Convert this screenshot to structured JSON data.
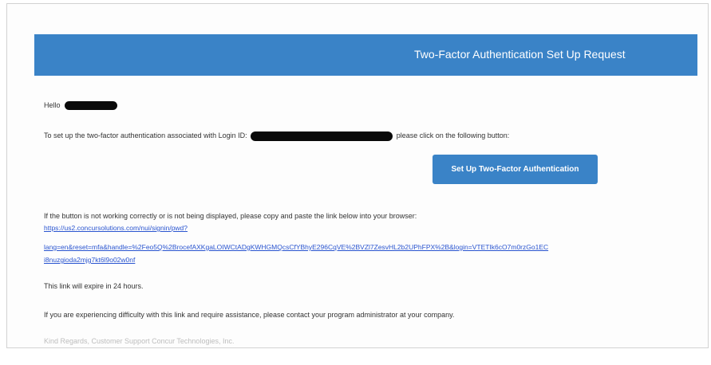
{
  "email": {
    "header_title": "Two-Factor Authentication Set Up Request",
    "greeting": "Hello",
    "setup_text_before": "To set up the two-factor authentication associated with Login ID:",
    "setup_text_after": "please click on the following button:",
    "button_label": "Set Up Two-Factor Authentication",
    "fallback_text": "If the button is not working correctly or is not being displayed, please copy and paste the link below into your browser:",
    "link_lines": [
      "https://us2.concursolutions.com/nui/signin/pwd?",
      "lang=en&reset=mfa&handle=%2Feo5Q%2BrocefAXKgaLOIWCtADgKWHGMQcsCfYBhyE296CqVE%2BVZl7ZesvHL2b2UPhFPX%2B&login=VTETIk6cO7m0rzGo1EC",
      "i8nuzgioda2mjg7kt6l9o02w0nf"
    ],
    "expiry_text": "This link will expire in 24 hours.",
    "assistance_text": "If you are experiencing difficulty with this link and require assistance, please contact your program administrator at your company.",
    "signoff_text": "Kind Regards, Customer Support Concur Technologies, Inc."
  }
}
